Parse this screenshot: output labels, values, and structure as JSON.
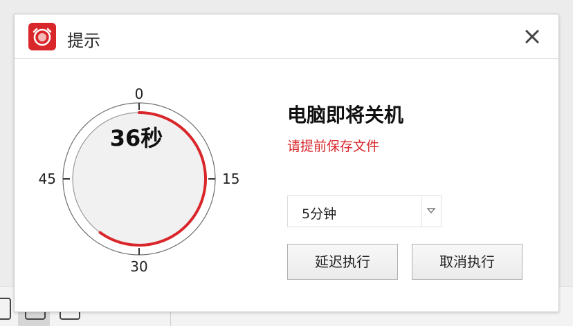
{
  "dialog": {
    "title": "提示",
    "app_icon": "alarm-clock-icon",
    "close_icon": "close-icon"
  },
  "dial": {
    "countdown_text": "36秒",
    "tick_labels": [
      "0",
      "15",
      "30",
      "45"
    ],
    "progress_fraction": 0.6,
    "progress_color": "#d9262a"
  },
  "message": {
    "heading": "电脑即将关机",
    "subtitle": "请提前保存文件"
  },
  "delay_select": {
    "value": "5分钟",
    "arrow_icon": "triangle-down-icon"
  },
  "buttons": {
    "delay_label": "延迟执行",
    "cancel_label": "取消执行"
  },
  "colors": {
    "accent": "#d9262a",
    "text": "#111111"
  }
}
